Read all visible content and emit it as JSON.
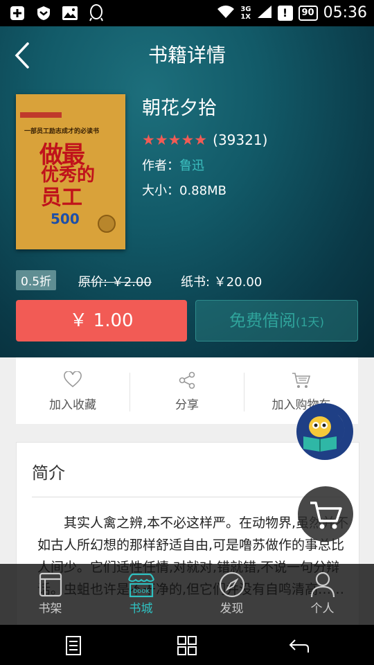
{
  "status_bar": {
    "net_top": "3G",
    "net_bottom": "1X",
    "battery": "90",
    "time": "05:36"
  },
  "header": {
    "title": "书籍详情"
  },
  "book": {
    "title": "朝花夕拾",
    "stars": "★★★★★",
    "rating_count": "(39321)",
    "author_label": "作者：",
    "author": "鲁迅",
    "size": "大小：0.88MB",
    "cover": {
      "subtitle": "一部员工励志成才的必读书",
      "line1": "做最",
      "line2": "优秀的",
      "line3": "员工",
      "number": "500"
    }
  },
  "pricing": {
    "discount": "0.5折",
    "original": "原价: ￥2.00",
    "paper": "纸书: ￥20.00"
  },
  "buttons": {
    "buy": "￥ 1.00",
    "borrow": "免费借阅",
    "borrow_note": "(1天)"
  },
  "actions": [
    {
      "label": "加入收藏",
      "icon": "heart-icon"
    },
    {
      "label": "分享",
      "icon": "share-icon"
    },
    {
      "label": "加入购物车",
      "icon": "cart-icon"
    }
  ],
  "intro": {
    "heading": "简介",
    "text": "其实人禽之辨,本不必这样严。在动物界,虽然并不如古人所幻想的那样舒适自由,可是噜苏做作的事总比人间少。它们适性任情,对就对,错就错,不说一句分辩话。虫蛆也许是不干净的,但它们并没有自鸣清高……"
  },
  "tabs": [
    {
      "label": "书架",
      "icon": "bookshelf-icon"
    },
    {
      "label": "书城",
      "icon": "bookstore-icon"
    },
    {
      "label": "发现",
      "icon": "compass-icon"
    },
    {
      "label": "个人",
      "icon": "person-icon"
    }
  ],
  "colors": {
    "accent": "#f25b55",
    "teal": "#2fc2c2",
    "hero": "#0f4f5e"
  }
}
